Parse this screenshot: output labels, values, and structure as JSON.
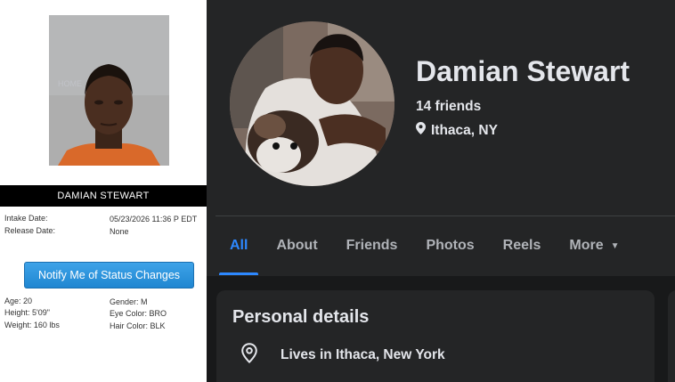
{
  "record": {
    "name": "DAMIAN STEWART",
    "intake_label": "Intake Date:",
    "intake_value": "05/23/2026 11:36 P EDT",
    "release_label": "Release Date:",
    "release_value": "None",
    "notify_button": "Notify Me of Status Changes",
    "age": "Age: 20",
    "height": "Height: 5'09\"",
    "weight": "Weight: 160 lbs",
    "gender": "Gender: M",
    "eye_color": "Eye Color: BRO",
    "hair_color": "Hair Color: BLK"
  },
  "profile": {
    "name": "Damian Stewart",
    "friends": "14 friends",
    "location": "Ithaca, NY",
    "tabs": [
      {
        "label": "All",
        "active": true
      },
      {
        "label": "About"
      },
      {
        "label": "Friends"
      },
      {
        "label": "Photos"
      },
      {
        "label": "Reels"
      },
      {
        "label": "More"
      }
    ],
    "personal_details": {
      "title": "Personal details",
      "lives_in": "Lives in Ithaca, New York"
    }
  },
  "colors": {
    "facebook_blue": "#2d88ff",
    "button_blue": "#1f86d1",
    "dark_bg": "#18191a",
    "card_bg": "#242526"
  },
  "icons": [
    "location-pin-icon",
    "map-pin-outline-icon",
    "caret-down-icon"
  ]
}
